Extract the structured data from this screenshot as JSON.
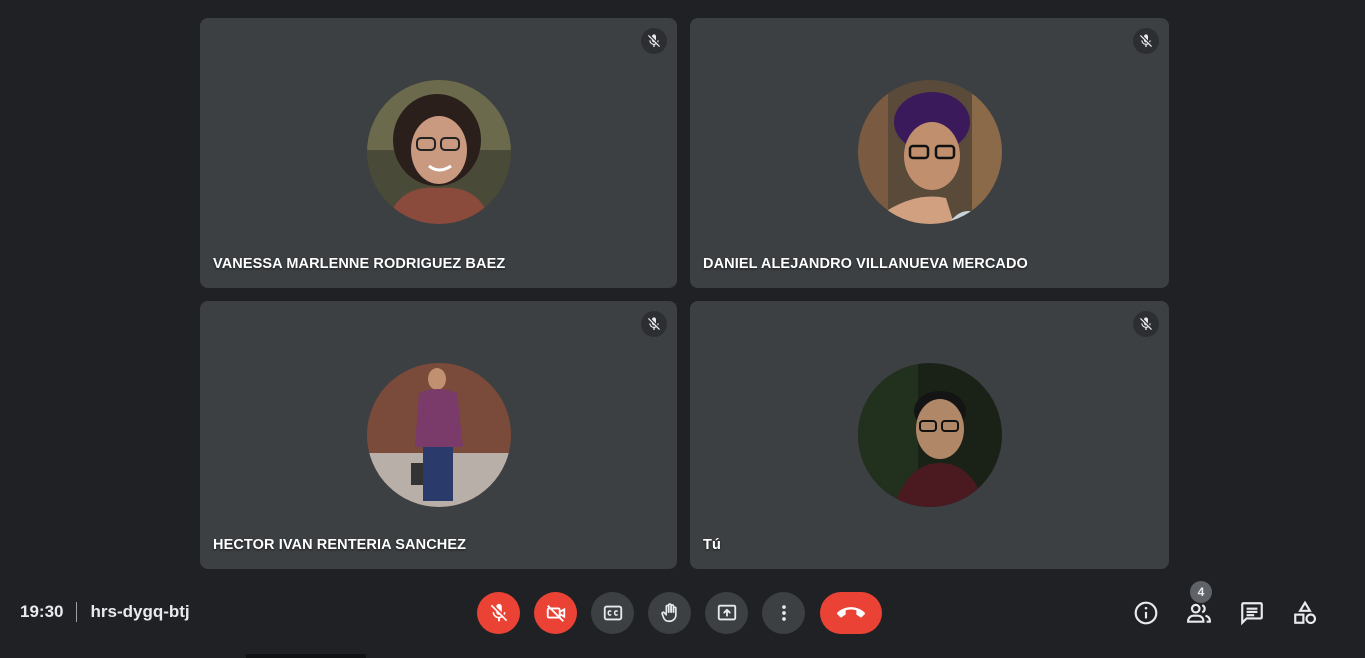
{
  "participants": [
    {
      "name": "VANESSA MARLENNE RODRIGUEZ BAEZ",
      "muted": true
    },
    {
      "name": "DANIEL ALEJANDRO VILLANUEVA MERCADO",
      "muted": true
    },
    {
      "name": "HECTOR IVAN RENTERIA SANCHEZ",
      "muted": true
    },
    {
      "name": "Tú",
      "muted": true
    }
  ],
  "meeting": {
    "time": "19:30",
    "code": "hrs-dygq-btj"
  },
  "controls": {
    "mic": {
      "icon": "mic-off-icon",
      "state": "off"
    },
    "camera": {
      "icon": "camera-off-icon",
      "state": "off"
    },
    "captions": {
      "icon": "closed-captions-icon"
    },
    "raise_hand": {
      "icon": "hand-icon"
    },
    "present": {
      "icon": "present-screen-icon"
    },
    "more": {
      "icon": "more-vert-icon"
    },
    "end_call": {
      "icon": "end-call-icon"
    }
  },
  "side_controls": {
    "info": {
      "icon": "info-icon"
    },
    "people": {
      "icon": "people-icon",
      "count": "4"
    },
    "chat": {
      "icon": "chat-icon"
    },
    "activities": {
      "icon": "activities-icon"
    }
  },
  "colors": {
    "background": "#202124",
    "tile": "#3c4043",
    "danger": "#ea4335"
  }
}
